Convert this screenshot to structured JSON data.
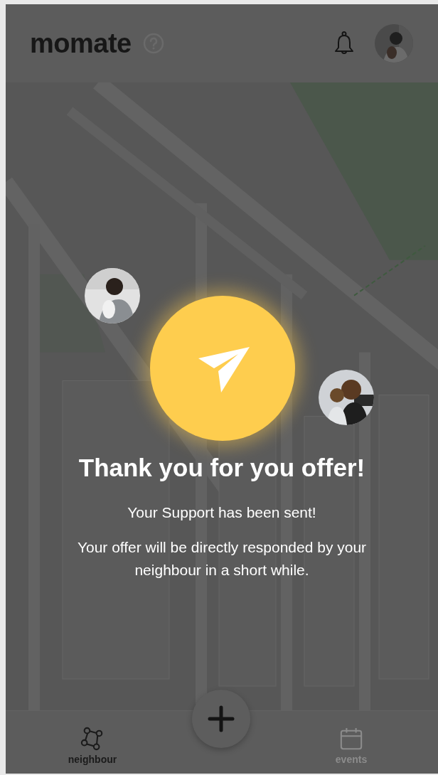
{
  "header": {
    "logo": "momate"
  },
  "confirmation": {
    "title": "Thank you for you offer!",
    "subtitle": "Your Support has been sent!",
    "message": "Your offer will be directly responded by your neighbour in a short while."
  },
  "nav": {
    "tabs": [
      {
        "label": "neighbour",
        "selected": true
      },
      {
        "label": "events",
        "selected": false
      }
    ]
  }
}
